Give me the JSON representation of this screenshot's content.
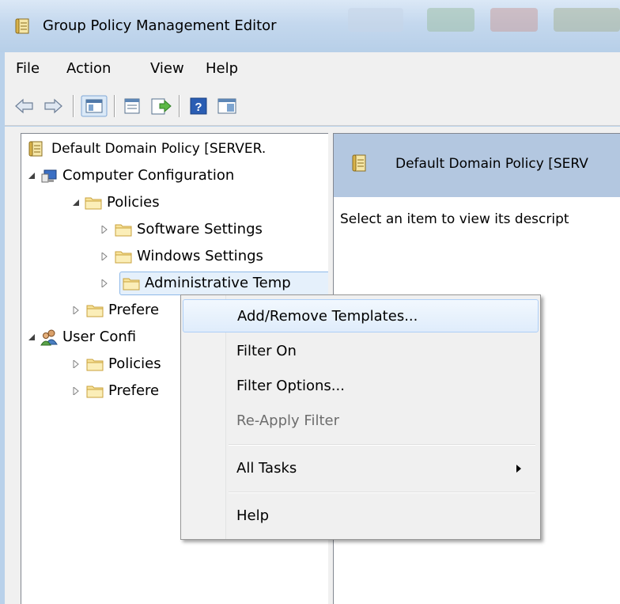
{
  "window": {
    "title": "Group Policy Management Editor"
  },
  "menubar": {
    "items": [
      "File",
      "Action",
      "View",
      "Help"
    ]
  },
  "toolbar": {
    "icons": [
      "back-arrow-icon",
      "forward-arrow-icon",
      "show-hide-console-tree-icon",
      "properties-icon",
      "export-list-icon",
      "help-icon",
      "show-hide-action-pane-icon"
    ]
  },
  "tree": {
    "root": "Default Domain Policy [SERVER.",
    "nodes": [
      {
        "label": "Computer Configuration"
      },
      {
        "label": "Policies"
      },
      {
        "label": "Software Settings"
      },
      {
        "label": "Windows Settings"
      },
      {
        "label": "Administrative Temp"
      },
      {
        "label": "Prefere"
      },
      {
        "label": "User Confi"
      },
      {
        "label": "Policies"
      },
      {
        "label": "Prefere"
      }
    ]
  },
  "rightpane": {
    "header": "Default Domain Policy [SERV",
    "description": "Select an item to view its descript"
  },
  "context_menu": {
    "items": [
      {
        "label": "Add/Remove Templates..."
      },
      {
        "label": "Filter On"
      },
      {
        "label": "Filter Options..."
      },
      {
        "label": "Re-Apply Filter"
      },
      {
        "label": "All Tasks"
      },
      {
        "label": "Help"
      }
    ]
  }
}
